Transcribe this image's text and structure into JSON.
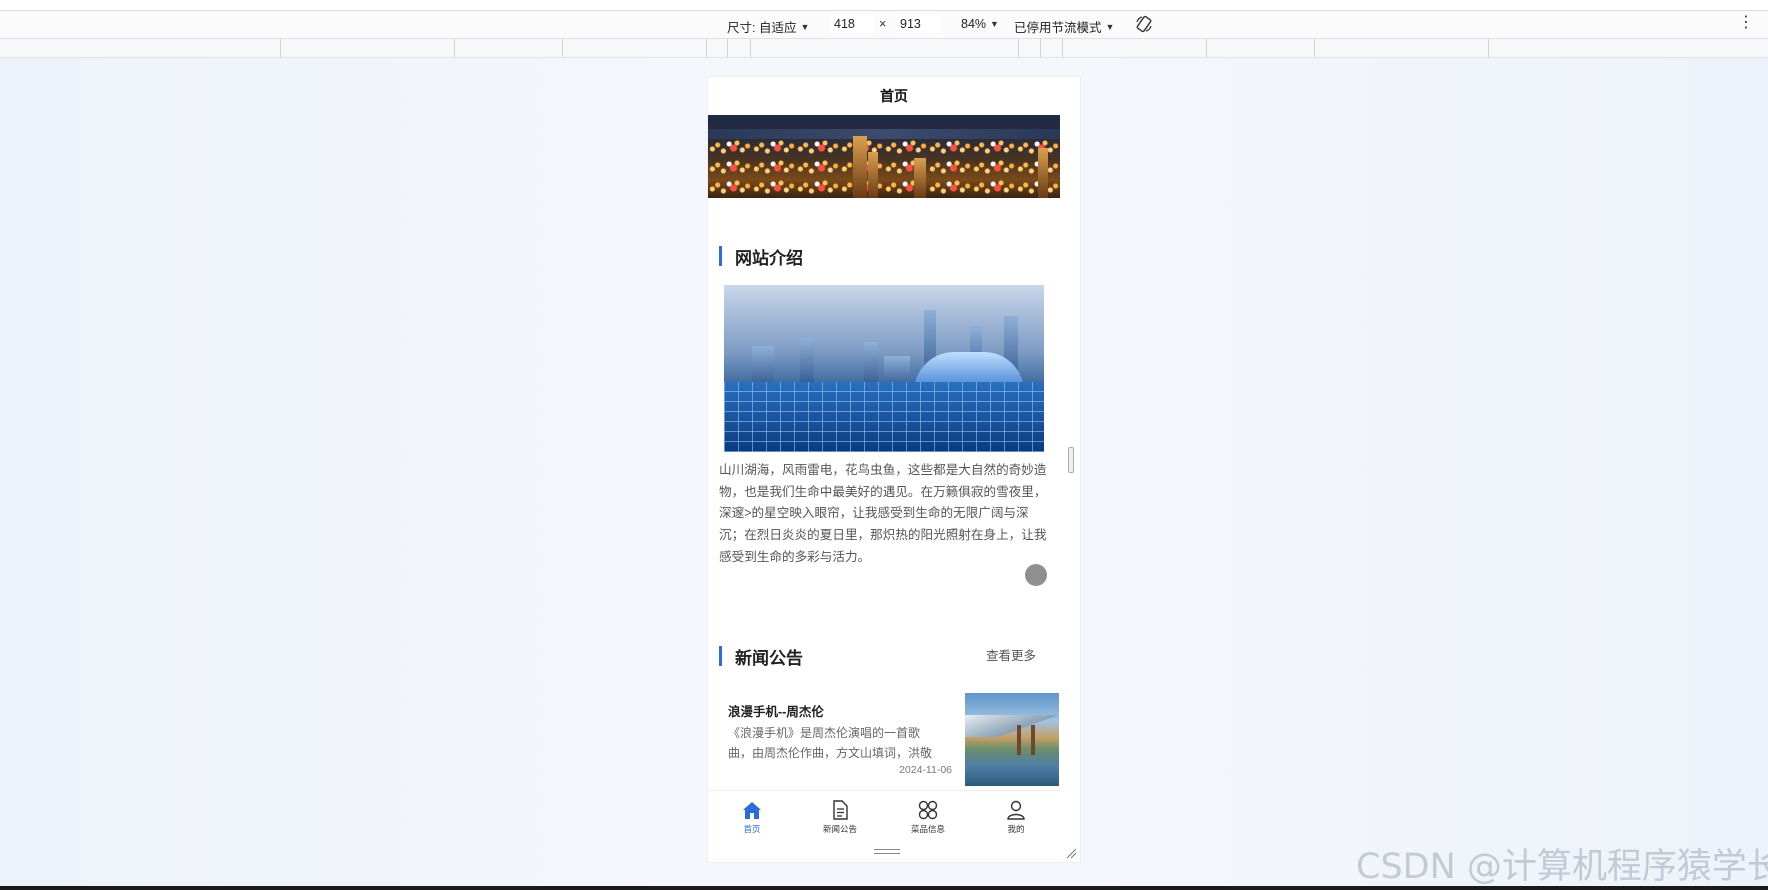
{
  "devtools": {
    "size_label": "尺寸: 自适应",
    "width": "418",
    "times": "×",
    "height": "913",
    "zoom": "84%",
    "throttle": "已停用节流模式",
    "menu_icon": "kebab-icon",
    "rotate_icon": "rotate-icon"
  },
  "page": {
    "nav_title": "首页",
    "intro": {
      "title": "网站介绍",
      "text": "山川湖海，风雨雷电，花鸟虫鱼，这些都是大自然的奇妙造物，也是我们生命中最美好的遇见。在万籁俱寂的雪夜里，深邃>的星空映入眼帘，让我感受到生命的无限广阔与深沉；在烈日炎炎的夏日里，那炽热的阳光照射在身上，让我感受到生命的多彩与活力。"
    },
    "news": {
      "title": "新闻公告",
      "more": "查看更多",
      "items": [
        {
          "title": "浪漫手机--周杰伦",
          "summary": "《浪漫手机》是周杰伦演唱的一首歌曲，由周杰伦作曲，方文山填词，洪敬",
          "date": "2024-11-06"
        }
      ]
    },
    "tabs": [
      {
        "label": "首页",
        "icon": "home-icon",
        "active": true
      },
      {
        "label": "新闻公告",
        "icon": "document-icon",
        "active": false
      },
      {
        "label": "菜品信息",
        "icon": "grid-icon",
        "active": false
      },
      {
        "label": "我的",
        "icon": "user-icon",
        "active": false
      }
    ]
  },
  "watermark": "CSDN @计算机程序猿学长",
  "colors": {
    "accent": "#2e6bd6"
  }
}
